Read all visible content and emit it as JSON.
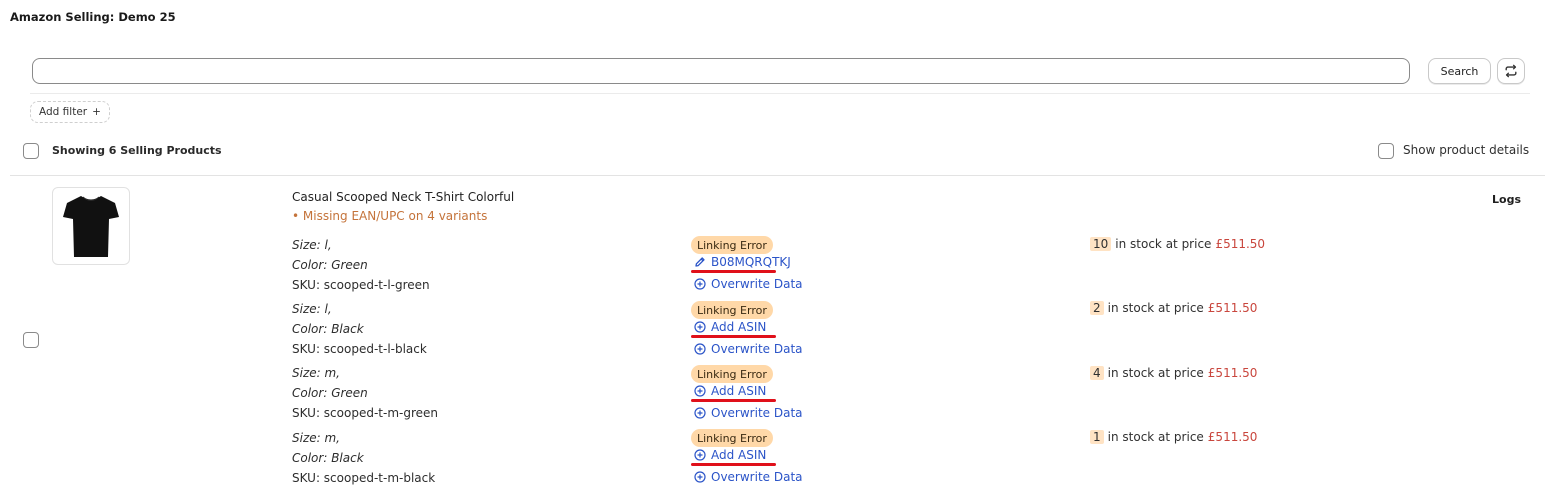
{
  "page_title": "Amazon Selling: Demo 25",
  "search": {
    "value": "",
    "button_label": "Search"
  },
  "filters": {
    "add_filter_label": "Add filter",
    "add_filter_symbol": "+"
  },
  "list_header": {
    "showing_label": "Showing 6 Selling Products",
    "show_details_label": "Show product details"
  },
  "colors": {
    "badge_bg": "#ffd8a8",
    "link_blue": "#2b54c8",
    "warning_orange": "#c4733a",
    "price_red": "#c9463d",
    "underline_red": "#e0101a"
  },
  "product": {
    "title": "Casual Scooped Neck T-Shirt Colorful",
    "warning": "Missing EAN/UPC on 4 variants",
    "logs_label": "Logs",
    "image_icon": "tshirt-icon",
    "variants": [
      {
        "size": "Size: l,",
        "color": "Color: Green",
        "sku": "SKU: scooped-t-l-green",
        "status": "Linking Error",
        "primary_action": "B08MQRQTKJ",
        "primary_icon": "pencil-icon",
        "secondary_action": "Overwrite Data",
        "qty": "10",
        "stock_text": "in stock at price",
        "price": "£511.50"
      },
      {
        "size": "Size: l,",
        "color": "Color: Black",
        "sku": "SKU: scooped-t-l-black",
        "status": "Linking Error",
        "primary_action": "Add ASIN",
        "primary_icon": "plus-circle-icon",
        "secondary_action": "Overwrite Data",
        "qty": "2",
        "stock_text": "in stock at price",
        "price": "£511.50"
      },
      {
        "size": "Size: m,",
        "color": "Color: Green",
        "sku": "SKU: scooped-t-m-green",
        "status": "Linking Error",
        "primary_action": "Add ASIN",
        "primary_icon": "plus-circle-icon",
        "secondary_action": "Overwrite Data",
        "qty": "4",
        "stock_text": "in stock at price",
        "price": "£511.50"
      },
      {
        "size": "Size: m,",
        "color": "Color: Black",
        "sku": "SKU: scooped-t-m-black",
        "status": "Linking Error",
        "primary_action": "Add ASIN",
        "primary_icon": "plus-circle-icon",
        "secondary_action": "Overwrite Data",
        "qty": "1",
        "stock_text": "in stock at price",
        "price": "£511.50"
      }
    ]
  }
}
